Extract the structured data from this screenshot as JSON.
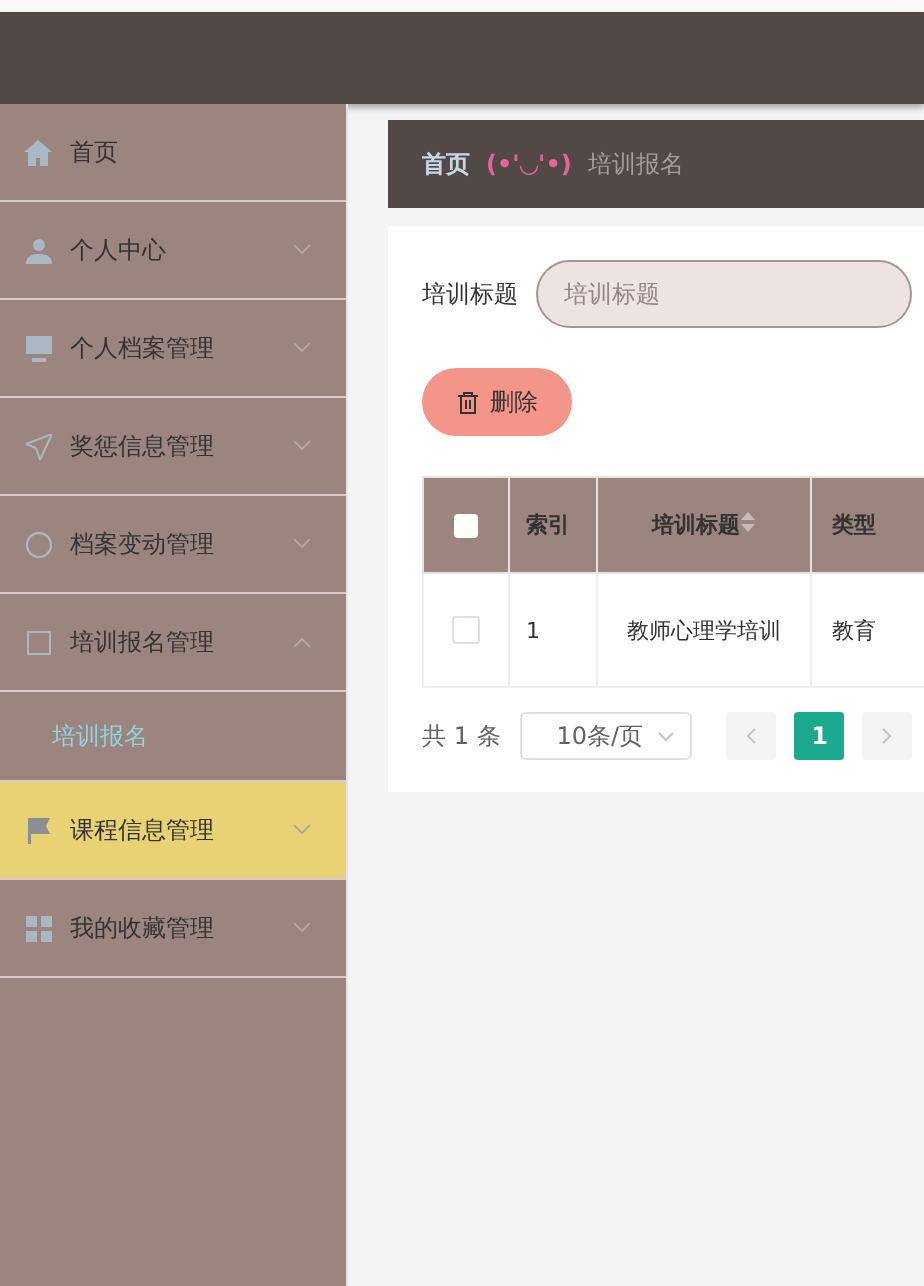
{
  "sidebar": {
    "items": [
      {
        "label": "首页",
        "expandable": false,
        "selected": false
      },
      {
        "label": "个人中心",
        "expandable": true,
        "expanded": false,
        "selected": false
      },
      {
        "label": "个人档案管理",
        "expandable": true,
        "expanded": false,
        "selected": false
      },
      {
        "label": "奖惩信息管理",
        "expandable": true,
        "expanded": false,
        "selected": false
      },
      {
        "label": "档案变动管理",
        "expandable": true,
        "expanded": false,
        "selected": false
      },
      {
        "label": "培训报名管理",
        "expandable": true,
        "expanded": true,
        "selected": false,
        "children": [
          {
            "label": "培训报名",
            "selected": true
          }
        ]
      },
      {
        "label": "课程信息管理",
        "expandable": true,
        "expanded": false,
        "selected": true
      },
      {
        "label": "我的收藏管理",
        "expandable": true,
        "expanded": false,
        "selected": false
      }
    ]
  },
  "breadcrumb": {
    "home": "首页",
    "separator": "(•'◡'•)",
    "current": "培训报名"
  },
  "search": {
    "label": "培训标题",
    "placeholder": "培训标题"
  },
  "delete_button": "删除",
  "table": {
    "select_all_checked": false,
    "columns": [
      {
        "label": "索引",
        "sortable": false
      },
      {
        "label": "培训标题",
        "sortable": true
      },
      {
        "label": "类型",
        "sortable": false
      }
    ],
    "rows": [
      {
        "checked": false,
        "cells": [
          "1",
          "教师心理学培训",
          "教育"
        ]
      }
    ]
  },
  "pagination": {
    "total": "共 1 条",
    "page_size": "10条/页",
    "pages": [
      {
        "label": "1",
        "selected": true
      }
    ]
  }
}
